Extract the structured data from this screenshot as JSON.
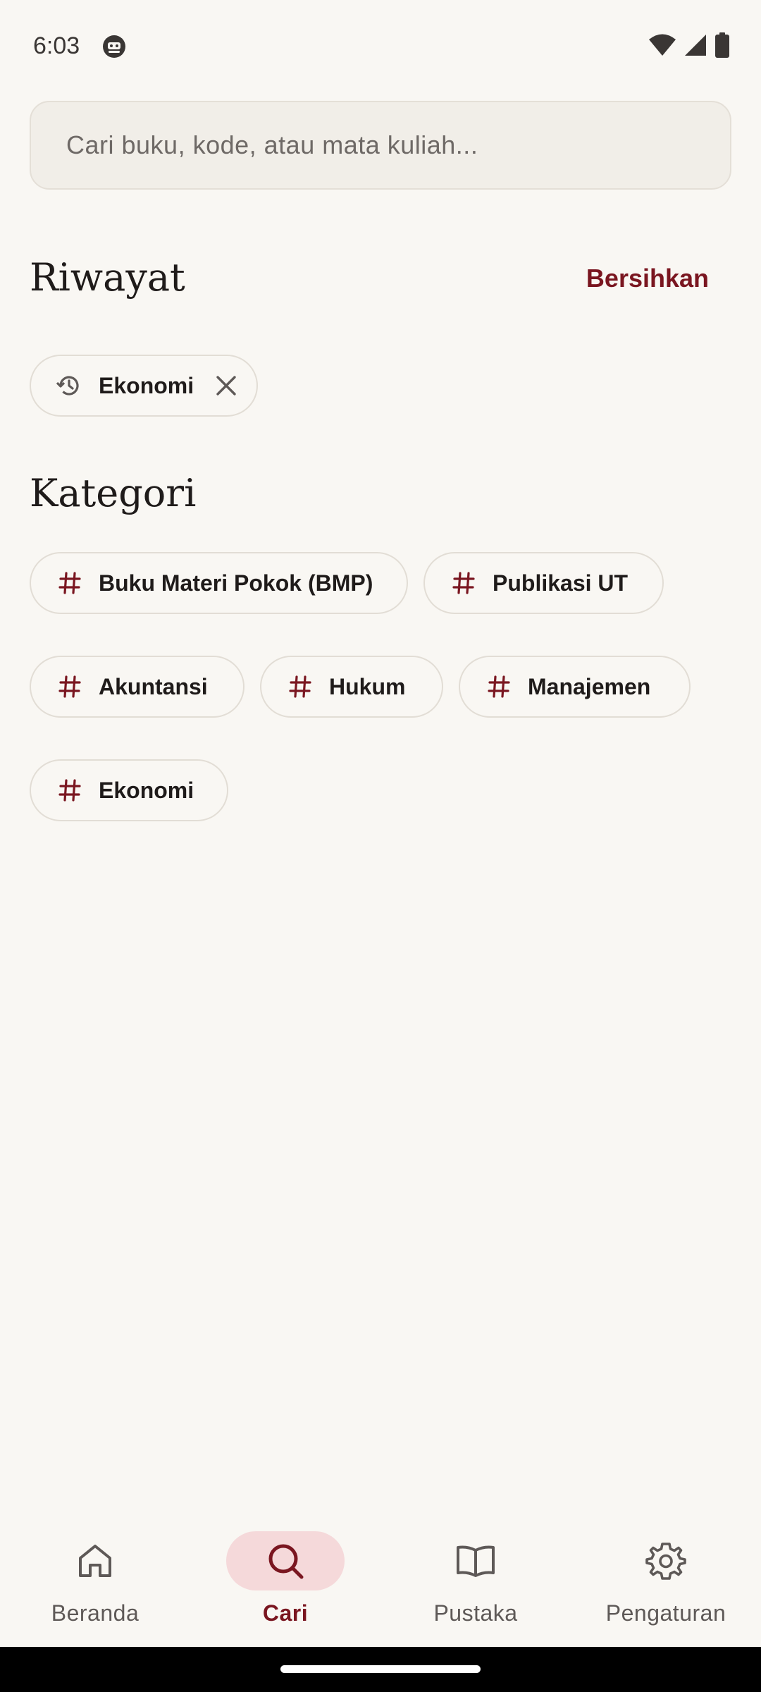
{
  "status_bar": {
    "time": "6:03"
  },
  "search": {
    "placeholder": "Cari buku, kode, atau mata kuliah...",
    "value": ""
  },
  "history": {
    "title": "Riwayat",
    "clear_label": "Bersihkan",
    "items": [
      {
        "label": "Ekonomi"
      }
    ]
  },
  "categories": {
    "title": "Kategori",
    "items": [
      {
        "label": "Buku Materi Pokok (BMP)"
      },
      {
        "label": "Publikasi UT"
      },
      {
        "label": "Akuntansi"
      },
      {
        "label": "Hukum"
      },
      {
        "label": "Manajemen"
      },
      {
        "label": "Ekonomi"
      }
    ]
  },
  "bottom_nav": {
    "items": [
      {
        "label": "Beranda",
        "icon": "home-icon"
      },
      {
        "label": "Cari",
        "icon": "search-icon",
        "active": true
      },
      {
        "label": "Pustaka",
        "icon": "book-icon"
      },
      {
        "label": "Pengaturan",
        "icon": "settings-icon"
      }
    ]
  },
  "colors": {
    "accent": "#7A1620",
    "accent_container": "#F5D9DA",
    "background": "#F9F7F3",
    "search_background": "#F1EEE8",
    "chip_border": "#E2DDD5"
  }
}
